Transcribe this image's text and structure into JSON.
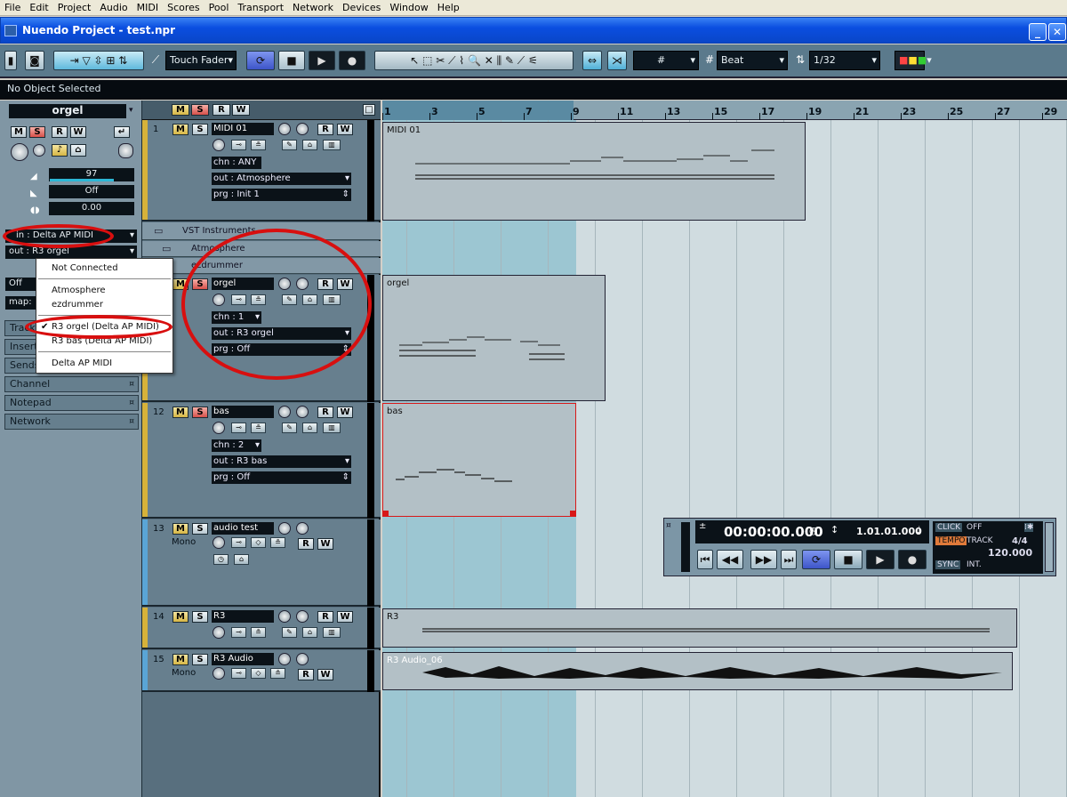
{
  "menu": [
    "File",
    "Edit",
    "Project",
    "Audio",
    "MIDI",
    "Scores",
    "Pool",
    "Transport",
    "Network",
    "Devices",
    "Window",
    "Help"
  ],
  "window": {
    "title": "Nuendo Project - test.npr"
  },
  "toolbar": {
    "automation_mode": "Touch Fader",
    "grid_type": "Beat",
    "quantize": "1/32"
  },
  "status": {
    "text": "No Object Selected"
  },
  "inspector": {
    "track_name": "orgel",
    "volume": "97",
    "pan": "Off",
    "delay": "0.00",
    "input": "in : Delta AP MIDI",
    "output": "out : R3 orgel",
    "off_field": "Off",
    "map_field": "map:",
    "sections": [
      "Track",
      "Inserts",
      "Sends",
      "Channel",
      "Notepad",
      "Network"
    ]
  },
  "output_menu": {
    "items": [
      "Not Connected",
      "Atmosphere",
      "ezdrummer",
      "R3 orgel (Delta AP MIDI)",
      "R3 bas (Delta AP MIDI)",
      "Delta AP MIDI"
    ],
    "checked": "R3 orgel (Delta AP MIDI)"
  },
  "tracks": [
    {
      "num": "1",
      "name": "MIDI 01",
      "chn": "chn : ANY",
      "out": "out : Atmosphere",
      "prg": "prg : Init 1",
      "color": "#d7b23a"
    },
    {
      "num": "",
      "name": "orgel",
      "chn": "chn : 1",
      "out": "out : R3 orgel",
      "prg": "prg : Off",
      "color": "#d7b23a"
    },
    {
      "num": "12",
      "name": "bas",
      "chn": "chn : 2",
      "out": "out : R3 bas",
      "prg": "prg : Off",
      "color": "#d7b23a"
    },
    {
      "num": "13",
      "name": "audio test",
      "mono": "Mono",
      "color": "#5aa5d6"
    },
    {
      "num": "14",
      "name": "R3",
      "color": "#d7b23a"
    },
    {
      "num": "15",
      "name": "R3 Audio",
      "mono": "Mono",
      "color": "#5aa5d6"
    }
  ],
  "folders": {
    "vst": "VST Instruments",
    "atmosphere": "Atmosphere",
    "ezdrummer": "ezdrummer"
  },
  "ruler": {
    "bars": [
      "1",
      "3",
      "5",
      "7",
      "9",
      "11",
      "13",
      "15",
      "17",
      "19",
      "21",
      "23",
      "25",
      "27",
      "29"
    ]
  },
  "parts": {
    "midi01": "MIDI 01",
    "orgel": "orgel",
    "bas": "bas",
    "r3": "R3",
    "r3audio": "R3 Audio_06"
  },
  "transport": {
    "time": "00:00:00.000",
    "bars": "1.01.01.000",
    "click_label": "CLICK",
    "click_value": "OFF",
    "tempo_label": "TEMPO",
    "tempo_mode": "TRACK",
    "signature": "4/4",
    "tempo": "120.000",
    "sync_label": "SYNC",
    "sync_value": "INT."
  },
  "colors": {
    "midi_track": "#d7b23a",
    "audio_track": "#5aa5d6",
    "highlight": "#d80f0f"
  }
}
